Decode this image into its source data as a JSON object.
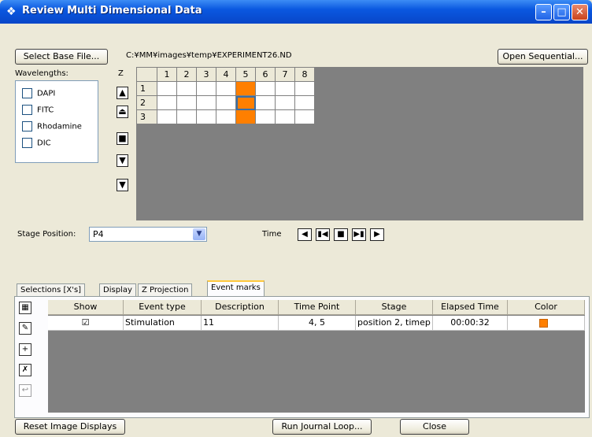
{
  "window": {
    "title": "Review Multi Dimensional Data",
    "title_icon": "app-logo-icon",
    "controls": [
      "minimize",
      "maximize",
      "close"
    ]
  },
  "top": {
    "select_base_file_label": "Select Base File...",
    "path": "C:¥MM¥images¥temp¥EXPERIMENT26.ND",
    "open_sequential_label": "Open Sequential..."
  },
  "wavelengths": {
    "label": "Wavelengths:",
    "items": [
      {
        "label": "DAPI",
        "checked": false
      },
      {
        "label": "FITC",
        "checked": false
      },
      {
        "label": "Rhodamine",
        "checked": false
      },
      {
        "label": "DIC",
        "checked": false
      }
    ]
  },
  "z": {
    "label": "Z",
    "buttons": [
      "z-first-icon",
      "z-up-icon",
      "z-stop-icon",
      "z-down-icon",
      "z-last-icon"
    ]
  },
  "grid": {
    "columns": [
      "1",
      "2",
      "3",
      "4",
      "5",
      "6",
      "7",
      "8"
    ],
    "rows": [
      "1",
      "2",
      "3"
    ],
    "highlighted_column": "5",
    "selected_cell": {
      "row": "2",
      "column": "5"
    },
    "highlight_color": "#ff7f00"
  },
  "stage": {
    "label": "Stage Position:",
    "value": "P4"
  },
  "time": {
    "label": "Time",
    "buttons": [
      "time-first-icon",
      "time-prev-icon",
      "time-stop-icon",
      "time-next-icon",
      "time-last-icon"
    ]
  },
  "tabs": [
    {
      "label": "Selections [X's]",
      "active": false
    },
    {
      "label": "Display",
      "active": false
    },
    {
      "label": "Z Projection",
      "active": false
    },
    {
      "label": "Event marks",
      "active": true
    }
  ],
  "event_tools": [
    "event-columns-icon",
    "event-edit-icon",
    "event-add-icon",
    "event-delete-icon",
    "event-disabled-icon"
  ],
  "events": {
    "columns": [
      "Show",
      "Event type",
      "Description",
      "Time Point",
      "Stage",
      "Elapsed Time",
      "Color"
    ],
    "rows": [
      {
        "show": "☑",
        "event_type": "Stimulation",
        "description": "11",
        "time_point": "4, 5",
        "stage": "position 2, timep",
        "elapsed": "00:00:32",
        "color": "#ff7f00"
      }
    ]
  },
  "bottom": {
    "reset_label": "Reset Image Displays",
    "run_journal_label": "Run Journal Loop...",
    "close_label": "Close"
  }
}
